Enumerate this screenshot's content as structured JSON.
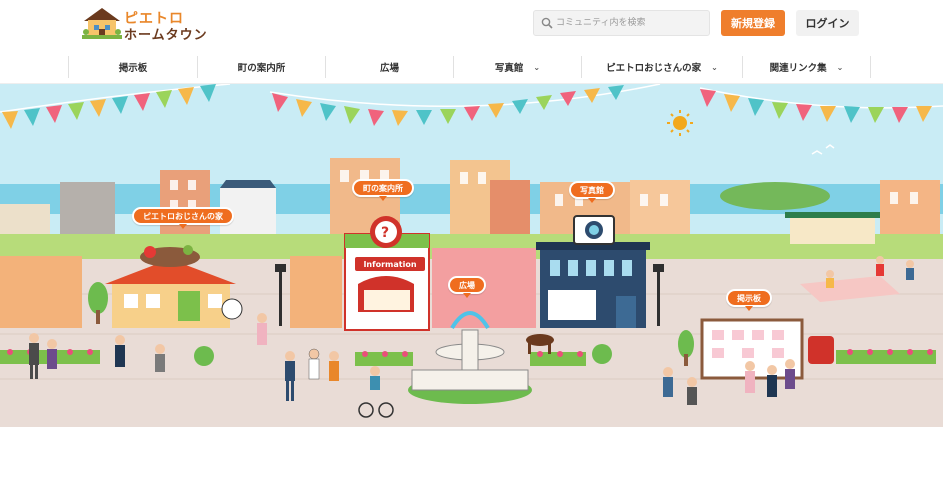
{
  "header": {
    "logo_line1": "ピエトロ",
    "logo_line2": "ホームタウン",
    "search_placeholder": "コミュニティ内を検索",
    "register_label": "新規登録",
    "login_label": "ログイン"
  },
  "nav": {
    "items": [
      {
        "label": "掲示板",
        "has_dropdown": false
      },
      {
        "label": "町の案内所",
        "has_dropdown": false
      },
      {
        "label": "広場",
        "has_dropdown": false
      },
      {
        "label": "写真館",
        "has_dropdown": true
      },
      {
        "label": "ピエトロおじさんの家",
        "has_dropdown": true
      },
      {
        "label": "関連リンク集",
        "has_dropdown": true
      }
    ]
  },
  "hero": {
    "bubbles": {
      "info": "町の案内所",
      "photo": "写真館",
      "house": "ピエトロおじさんの家",
      "plaza": "広場",
      "board": "掲示板"
    },
    "info_sign": "Information"
  },
  "colors": {
    "accent": "#ef7e2c",
    "sky": "#c9ecf5",
    "plaza": "#e9dcd6"
  }
}
